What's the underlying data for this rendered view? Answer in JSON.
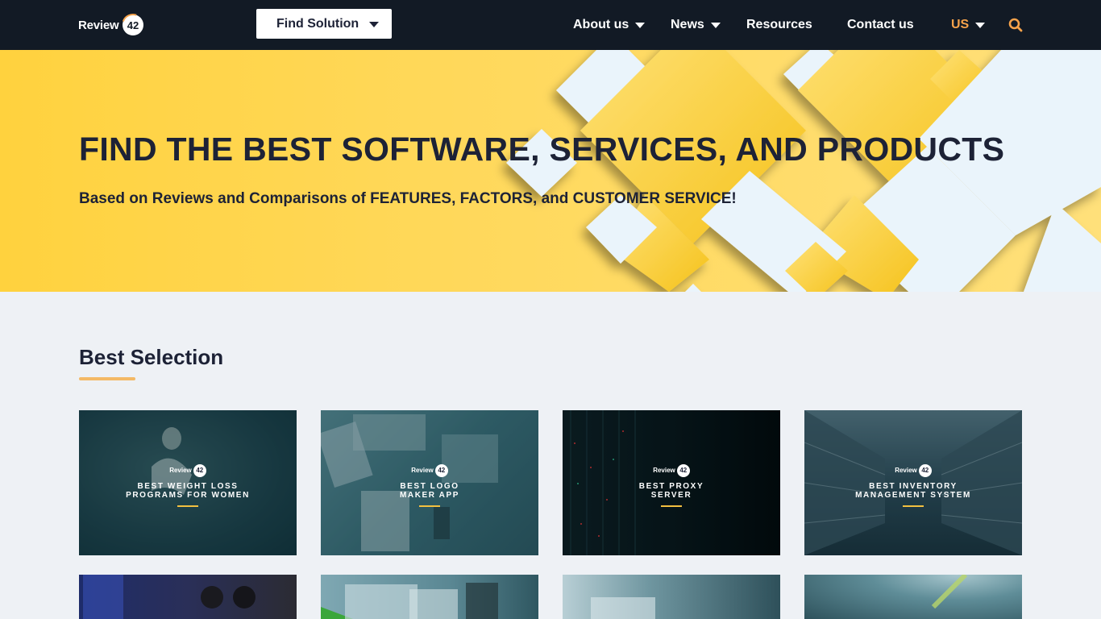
{
  "nav": {
    "logo_text": "Review",
    "logo_badge": "42",
    "find_solution": "Find Solution",
    "items": [
      {
        "label": "About us",
        "dropdown": true
      },
      {
        "label": "News",
        "dropdown": true
      },
      {
        "label": "Resources",
        "dropdown": false
      },
      {
        "label": "Contact us",
        "dropdown": false
      }
    ],
    "region": "US"
  },
  "hero": {
    "title": "FIND THE BEST SOFTWARE, SERVICES, AND PRODUCTS",
    "subtitle": "Based on Reviews and Comparisons of FEATURES, FACTORS, and CUSTOMER SERVICE!"
  },
  "section": {
    "title": "Best Selection"
  },
  "cards": [
    {
      "label_line1": "BEST WEIGHT LOSS",
      "label_line2": "PROGRAMS FOR WOMEN",
      "logo": "Review",
      "badge": "42"
    },
    {
      "label_line1": "BEST LOGO",
      "label_line2": "MAKER APP",
      "logo": "Review",
      "badge": "42"
    },
    {
      "label_line1": "BEST PROXY",
      "label_line2": "SERVER",
      "logo": "Review",
      "badge": "42"
    },
    {
      "label_line1": "BEST INVENTORY",
      "label_line2": "MANAGEMENT SYSTEM",
      "logo": "Review",
      "badge": "42"
    }
  ],
  "colors": {
    "nav_bg": "#121a25",
    "hero_yellow": "#ffd23e",
    "accent_orange": "#f7a34b",
    "page_bg": "#eef1f5",
    "text_dark": "#1d2236"
  }
}
